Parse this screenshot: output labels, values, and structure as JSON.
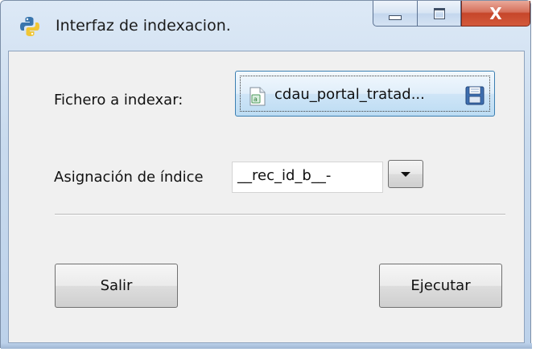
{
  "window": {
    "title": "Interfaz de indexacion.",
    "close_glyph": "X"
  },
  "form": {
    "file_label": "Fichero a indexar:",
    "file_button_text": "cdau_portal_tratad...",
    "index_label": "Asignación de índice",
    "index_value": "__rec_id_b__-"
  },
  "buttons": {
    "exit": "Salir",
    "run": "Ejecutar"
  },
  "colors": {
    "close_button": "#c6462a",
    "file_button_border": "#3c7fb1",
    "client_background": "#f0f0f0"
  },
  "icons": {
    "app": "python-icon",
    "file": "file-icon",
    "open": "folder-icon",
    "dropdown": "chevron-down-icon"
  }
}
